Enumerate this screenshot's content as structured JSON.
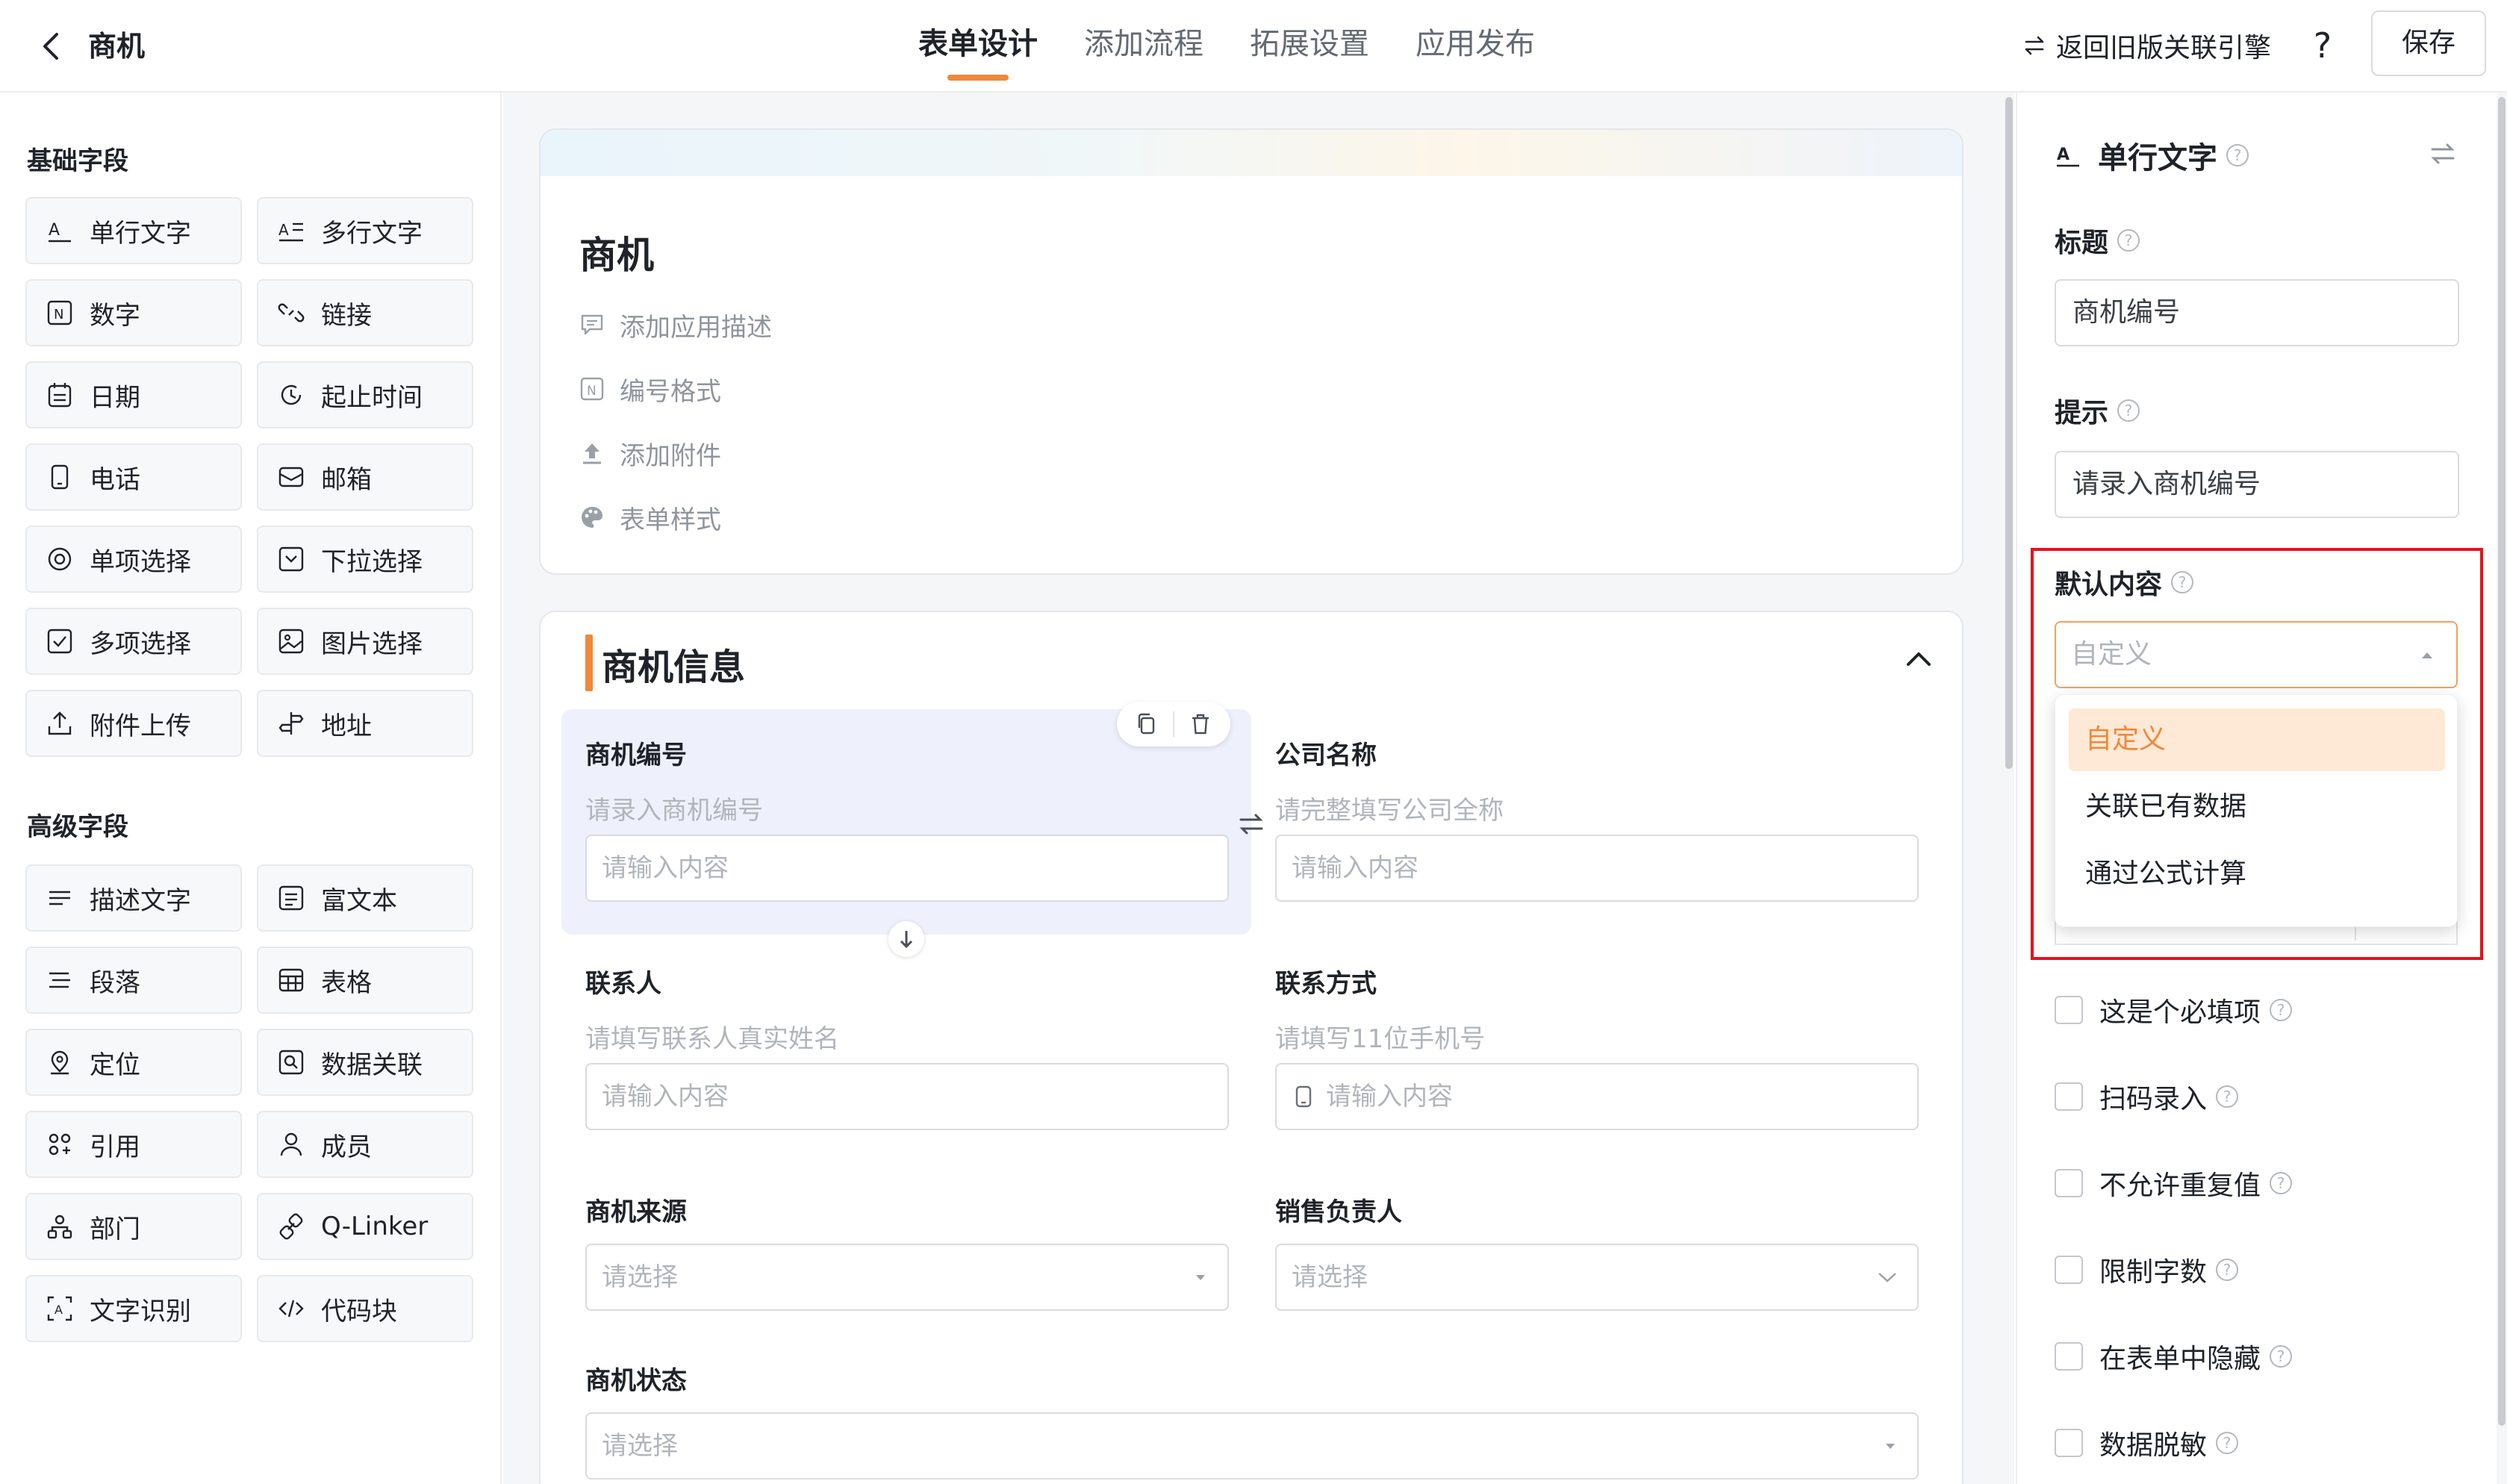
{
  "topbar": {
    "app_title": "商机",
    "tabs": [
      {
        "label": "表单设计",
        "active": true
      },
      {
        "label": "添加流程",
        "active": false
      },
      {
        "label": "拓展设置",
        "active": false
      },
      {
        "label": "应用发布",
        "active": false
      }
    ],
    "old_engine_label": "返回旧版关联引擎",
    "help_label": "?",
    "save_label": "保存"
  },
  "left_panel": {
    "basic_title": "基础字段",
    "basic_fields": [
      {
        "label": "单行文字",
        "icon": "single-line-text-icon"
      },
      {
        "label": "多行文字",
        "icon": "multi-line-text-icon"
      },
      {
        "label": "数字",
        "icon": "number-icon"
      },
      {
        "label": "链接",
        "icon": "link-icon"
      },
      {
        "label": "日期",
        "icon": "date-icon"
      },
      {
        "label": "起止时间",
        "icon": "time-range-icon"
      },
      {
        "label": "电话",
        "icon": "phone-icon"
      },
      {
        "label": "邮箱",
        "icon": "email-icon"
      },
      {
        "label": "单项选择",
        "icon": "radio-icon"
      },
      {
        "label": "下拉选择",
        "icon": "dropdown-icon"
      },
      {
        "label": "多项选择",
        "icon": "checkbox-icon"
      },
      {
        "label": "图片选择",
        "icon": "image-select-icon"
      },
      {
        "label": "附件上传",
        "icon": "upload-icon"
      },
      {
        "label": "地址",
        "icon": "address-icon"
      }
    ],
    "advanced_title": "高级字段",
    "advanced_fields": [
      {
        "label": "描述文字",
        "icon": "description-icon"
      },
      {
        "label": "富文本",
        "icon": "rich-text-icon"
      },
      {
        "label": "段落",
        "icon": "paragraph-icon"
      },
      {
        "label": "表格",
        "icon": "table-icon"
      },
      {
        "label": "定位",
        "icon": "location-icon"
      },
      {
        "label": "数据关联",
        "icon": "data-link-icon"
      },
      {
        "label": "引用",
        "icon": "reference-icon"
      },
      {
        "label": "成员",
        "icon": "member-icon"
      },
      {
        "label": "部门",
        "icon": "department-icon"
      },
      {
        "label": "Q-Linker",
        "icon": "q-linker-icon"
      },
      {
        "label": "文字识别",
        "icon": "ocr-icon"
      },
      {
        "label": "代码块",
        "icon": "code-block-icon"
      }
    ]
  },
  "form_header": {
    "title": "商机",
    "items": [
      {
        "label": "添加应用描述",
        "icon": "comment-icon"
      },
      {
        "label": "编号格式",
        "icon": "number-format-icon"
      },
      {
        "label": "添加附件",
        "icon": "upload-icon"
      },
      {
        "label": "表单样式",
        "icon": "palette-icon"
      }
    ]
  },
  "section": {
    "title": "商机信息",
    "fields": [
      {
        "label": "商机编号",
        "hint": "请录入商机编号",
        "placeholder": "请输入内容",
        "type": "text"
      },
      {
        "label": "公司名称",
        "hint": "请完整填写公司全称",
        "placeholder": "请输入内容",
        "type": "text"
      },
      {
        "label": "联系人",
        "hint": "请填写联系人真实姓名",
        "placeholder": "请输入内容",
        "type": "text"
      },
      {
        "label": "联系方式",
        "hint": "请填写11位手机号",
        "placeholder": "请输入内容",
        "type": "phone"
      },
      {
        "label": "商机来源",
        "hint": "",
        "placeholder": "请选择",
        "type": "select"
      },
      {
        "label": "销售负责人",
        "hint": "",
        "placeholder": "请选择",
        "type": "select"
      },
      {
        "label": "商机状态",
        "hint": "",
        "placeholder": "请选择",
        "type": "select"
      }
    ]
  },
  "right_panel": {
    "field_type": "单行文字",
    "title_label": "标题",
    "title_value": "商机编号",
    "hint_label": "提示",
    "hint_value": "请录入商机编号",
    "default_label": "默认内容",
    "default_select_value": "自定义",
    "default_options": [
      "自定义",
      "关联已有数据",
      "通过公式计算"
    ],
    "checkboxes": [
      {
        "label": "这是个必填项",
        "checked": false
      },
      {
        "label": "扫码录入",
        "checked": false
      },
      {
        "label": "不允许重复值",
        "checked": false
      },
      {
        "label": "限制字数",
        "checked": false
      },
      {
        "label": "在表单中隐藏",
        "checked": false
      },
      {
        "label": "数据脱敏",
        "checked": false
      }
    ],
    "help_mark": "?"
  },
  "colors": {
    "accent": "#f0883a",
    "accent_light": "#fde9d6",
    "highlight_box": "#e5121c",
    "selected_field_bg": "#eef1fb"
  }
}
